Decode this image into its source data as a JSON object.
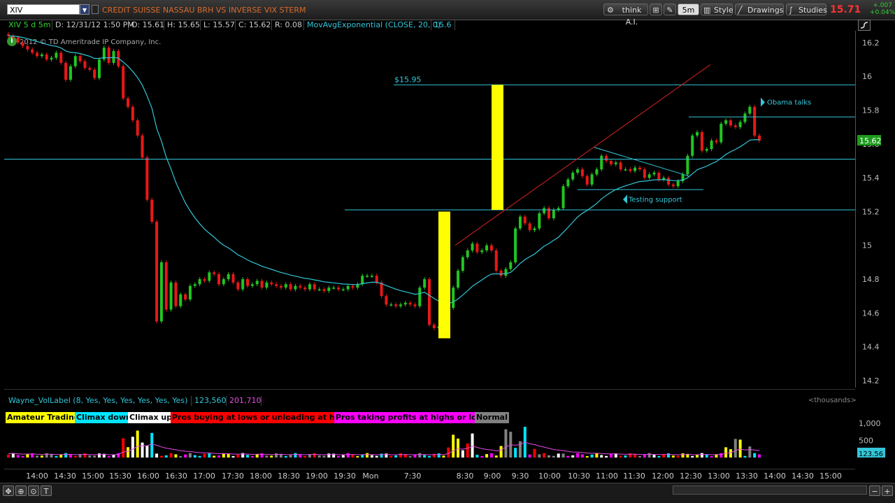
{
  "toolbar": {
    "symbol": "XIV",
    "description": "CREDIT SUISSE NASSAU BRH VS INVERSE VIX STERM",
    "think_ai": "think A.I.",
    "interval": "5m",
    "style": "Style",
    "drawings": "Drawings",
    "studies": "Studies",
    "last_price": "15.71",
    "change": "+.007",
    "change_pct": "+0.04%"
  },
  "info": {
    "period": "XIV 5 d 5m",
    "date": "D: 12/31/12 1:50 PM",
    "open": "O: 15.61",
    "high": "H: 15.65",
    "low": "L: 15.57",
    "close": "C: 15.62",
    "range": "R: 0.08",
    "study": "MovAvgExponential (CLOSE, 20, 0)",
    "study_value": "15.6"
  },
  "copyright": "2012 © TD Ameritrade IP Company, Inc.",
  "price_axis": {
    "ticks": [
      "16.2",
      "16",
      "15.8",
      "15.6",
      "15.4",
      "15.2",
      "15",
      "14.8",
      "14.6",
      "14.4",
      "14.2"
    ],
    "current": "15.62"
  },
  "annotations": {
    "level_label": "$15.95",
    "obama": "Obama talks",
    "testing": "Testing support"
  },
  "volume": {
    "study": "Wayne_VolLabel (8, Yes, Yes, Yes, Yes, Yes, Yes)",
    "value1": "123,560",
    "value2": "201,710",
    "units": "<thousands>",
    "ticks": [
      "1,000",
      "500"
    ],
    "current": "123.56",
    "legend": [
      {
        "label": "Amateur Trading",
        "color": "#ffff00"
      },
      {
        "label": "Climax down",
        "color": "#00e5ff"
      },
      {
        "label": "Climax up",
        "color": "#ffffff"
      },
      {
        "label": "Pros buying at lows or unloading at highs",
        "color": "#ff0000"
      },
      {
        "label": "Pros taking profits at highs or lows",
        "color": "#ff00ff"
      },
      {
        "label": "Normal",
        "color": "#808080"
      }
    ]
  },
  "time_axis": [
    "14:00",
    "14:30",
    "15:00",
    "15:30",
    "16:00",
    "16:30",
    "17:00",
    "17:30",
    "18:00",
    "18:30",
    "19:00",
    "19:30",
    "Mon",
    "7:30",
    "8:30",
    "9:00",
    "9:30",
    "10:00",
    "10:30",
    "11:00",
    "11:30",
    "12:00",
    "12:30",
    "13:00",
    "13:30",
    "14:00",
    "14:30",
    "15:00"
  ],
  "colors": {
    "up": "#21c521",
    "down": "#e81818",
    "ema": "#33c6d8",
    "highlight": "#ffff00",
    "accent": "#d86a2a"
  },
  "chart_data": {
    "type": "candlestick",
    "ylim": [
      14.15,
      16.27
    ],
    "ema_period": 20,
    "horizontal_levels": [
      15.95,
      15.76,
      15.51,
      15.21
    ],
    "closes": [
      16.24,
      16.23,
      16.2,
      16.18,
      16.16,
      16.14,
      16.12,
      16.13,
      16.1,
      16.11,
      16.14,
      16.08,
      15.98,
      16.06,
      16.12,
      16.09,
      16.05,
      16.04,
      15.99,
      16.1,
      16.17,
      16.08,
      16.15,
      16.06,
      15.87,
      15.82,
      15.74,
      15.65,
      15.52,
      15.27,
      15.14,
      14.55,
      14.9,
      14.62,
      14.78,
      14.64,
      14.71,
      14.68,
      14.76,
      14.77,
      14.8,
      14.79,
      14.84,
      14.83,
      14.77,
      14.8,
      14.83,
      14.78,
      14.74,
      14.8,
      14.76,
      14.77,
      14.79,
      14.75,
      14.78,
      14.77,
      14.76,
      14.75,
      14.77,
      14.74,
      14.76,
      14.75,
      14.74,
      14.77,
      14.74,
      14.74,
      14.73,
      14.75,
      14.75,
      14.74,
      14.74,
      14.76,
      14.75,
      14.77,
      14.82,
      14.82,
      14.82,
      14.78,
      14.7,
      14.65,
      14.65,
      14.64,
      14.65,
      14.66,
      14.65,
      14.64,
      14.75,
      14.8,
      14.53,
      14.51,
      14.52,
      14.55,
      14.63,
      14.75,
      14.85,
      14.93,
      14.97,
      15.01,
      14.96,
      14.97,
      15.0,
      14.97,
      14.85,
      14.82,
      14.86,
      14.9,
      15.1,
      15.17,
      15.13,
      15.09,
      15.1,
      15.19,
      15.22,
      15.16,
      15.21,
      15.22,
      15.35,
      15.39,
      15.43,
      15.45,
      15.41,
      15.36,
      15.42,
      15.45,
      15.53,
      15.5,
      15.48,
      15.49,
      15.45,
      15.45,
      15.44,
      15.46,
      15.45,
      15.4,
      15.42,
      15.43,
      15.39,
      15.4,
      15.36,
      15.35,
      15.38,
      15.42,
      15.53,
      15.65,
      15.67,
      15.56,
      15.57,
      15.62,
      15.61,
      15.72,
      15.74,
      15.71,
      15.7,
      15.73,
      15.78,
      15.82,
      15.65,
      15.62
    ]
  }
}
